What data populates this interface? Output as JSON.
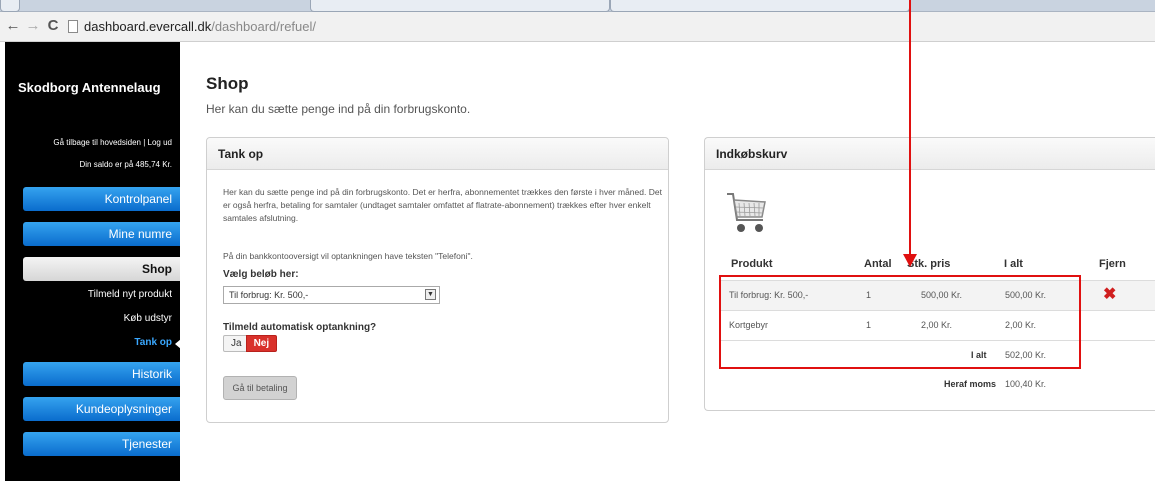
{
  "browser": {
    "back": "←",
    "forward": "→",
    "reload": "C",
    "url_host": "dashboard.evercall.dk",
    "url_path": "/dashboard/refuel/"
  },
  "sidebar": {
    "site_title": "Skodborg Antennelaug",
    "top_links": "Gå tilbage til hovedsiden | Log ud",
    "balance": "Din saldo er på 485,74 Kr.",
    "nav": {
      "kontrolpanel": "Kontrolpanel",
      "mine_numre": "Mine numre",
      "shop": "Shop",
      "tilmeld": "Tilmeld nyt produkt",
      "koeb_udstyr": "Køb udstyr",
      "tank_op": "Tank op",
      "historik": "Historik",
      "kundeoplysninger": "Kundeoplysninger",
      "tjenester": "Tjenester"
    }
  },
  "main": {
    "title": "Shop",
    "subtitle": "Her kan du sætte penge ind på din forbrugskonto."
  },
  "tank_panel": {
    "heading": "Tank op",
    "intro": "Her kan du sætte penge ind på din forbrugskonto. Det er herfra, abonnementet trækkes den første i hver måned. Det er også herfra, betaling for samtaler (undtaget samtaler omfattet af flatrate-abonnement) trækkes efter hver enkelt samtales afslutning.",
    "note": "På din bankkontooversigt vil optankningen have teksten \"Telefoni\".",
    "amount_label": "Vælg beløb her:",
    "amount_selected": "Til forbrug: Kr. 500,-",
    "auto_label": "Tilmeld automatisk optankning?",
    "toggle_yes": "Ja",
    "toggle_no": "Nej",
    "pay_button": "Gå til betaling"
  },
  "cart_panel": {
    "heading": "Indkøbskurv",
    "columns": {
      "product": "Produkt",
      "qty": "Antal",
      "unit_price": "Stk. pris",
      "total": "I alt",
      "remove": "Fjern"
    },
    "rows": [
      {
        "product": "Til forbrug: Kr. 500,-",
        "qty": "1",
        "unit_price": "500,00 Kr.",
        "total": "500,00 Kr."
      },
      {
        "product": "Kortgebyr",
        "qty": "1",
        "unit_price": "2,00 Kr.",
        "total": "2,00 Kr."
      }
    ],
    "total_label": "I alt",
    "total_value": "502,00 Kr.",
    "vat_label": "Heraf moms",
    "vat_value": "100,40 Kr."
  },
  "icons": {
    "remove": "✖",
    "select_arrow": "▼"
  },
  "colors": {
    "accent_blue": "#0a6ccd",
    "highlight_red": "#e01010",
    "toggle_no": "#d9312b"
  }
}
